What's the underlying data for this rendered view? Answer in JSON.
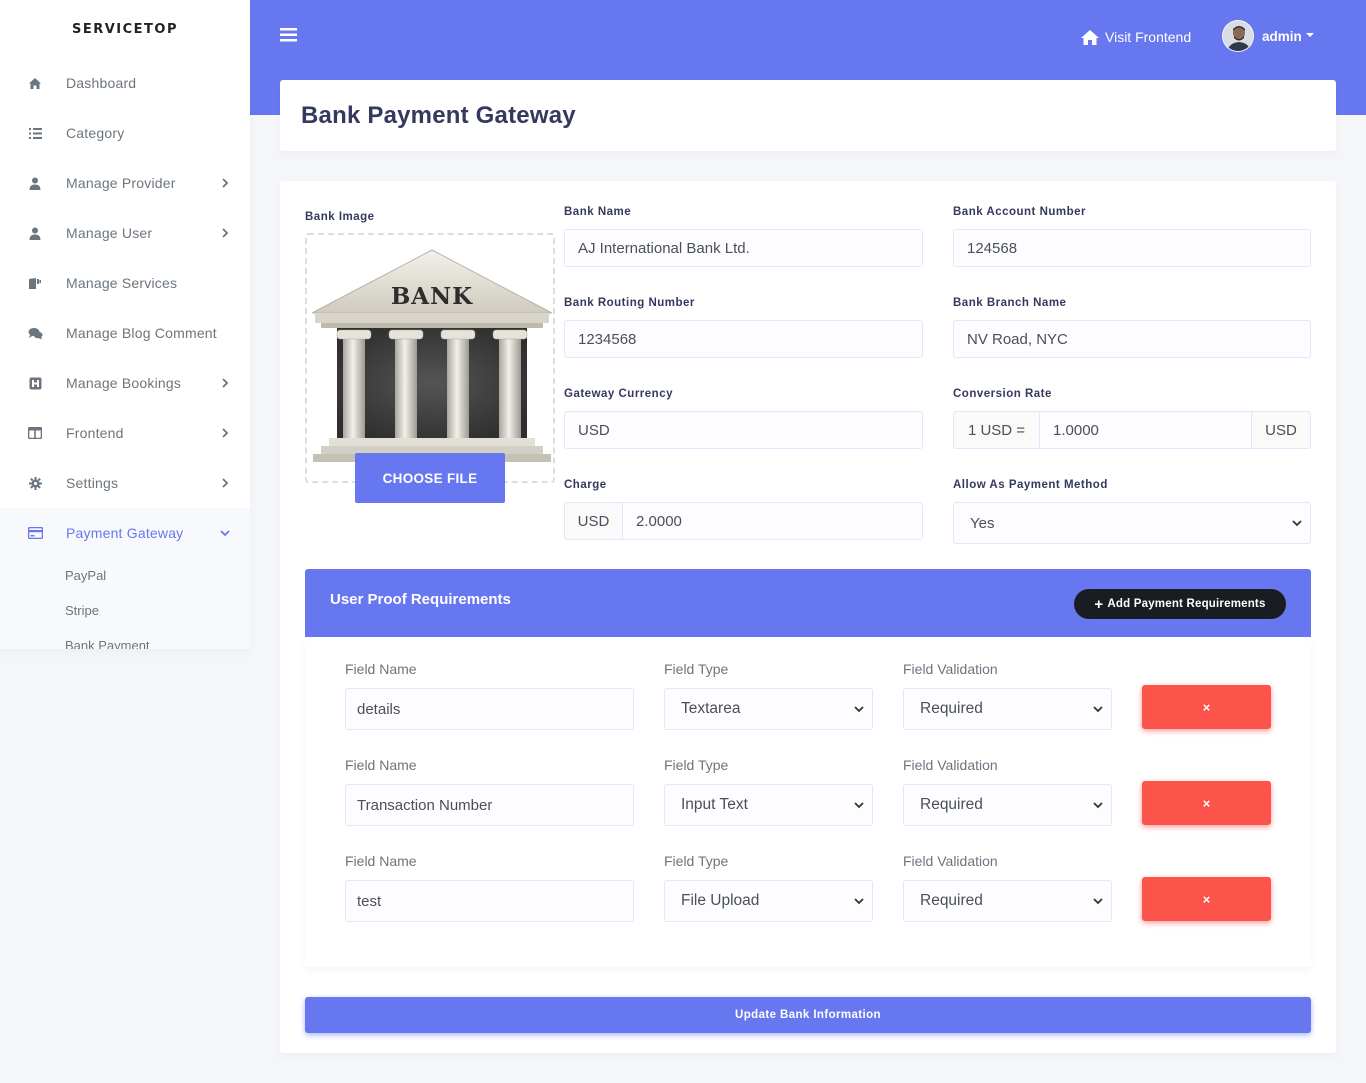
{
  "brand": "SERVICETOP",
  "sidebar": {
    "items": [
      {
        "label": "Dashboard",
        "icon": "home-icon",
        "has_chevron": false
      },
      {
        "label": "Category",
        "icon": "list-icon",
        "has_chevron": false
      },
      {
        "label": "Manage Provider",
        "icon": "user-icon",
        "has_chevron": true
      },
      {
        "label": "Manage User",
        "icon": "user-icon",
        "has_chevron": true
      },
      {
        "label": "Manage Services",
        "icon": "services-icon",
        "has_chevron": false
      },
      {
        "label": "Manage Blog Comment",
        "icon": "comments-icon",
        "has_chevron": false
      },
      {
        "label": "Manage Bookings",
        "icon": "bookings-icon",
        "has_chevron": true
      },
      {
        "label": "Frontend",
        "icon": "columns-icon",
        "has_chevron": true
      },
      {
        "label": "Settings",
        "icon": "gear-icon",
        "has_chevron": true
      },
      {
        "label": "Payment Gateway",
        "icon": "credit-card-icon",
        "has_chevron": true,
        "active": true
      }
    ],
    "subitems": [
      "PayPal",
      "Stripe",
      "Bank Payment"
    ]
  },
  "topbar": {
    "visit_frontend": "Visit Frontend",
    "user_name": "admin"
  },
  "page_title": "Bank Payment Gateway",
  "form": {
    "bank_image_label": "Bank Image",
    "bank_image_text": "BANK",
    "choose_file": "CHOOSE FILE",
    "bank_name_label": "Bank Name",
    "bank_name": "AJ International Bank Ltd.",
    "account_number_label": "Bank Account Number",
    "account_number": "124568",
    "routing_number_label": "Bank Routing Number",
    "routing_number": "1234568",
    "branch_name_label": "Bank Branch Name",
    "branch_name": "NV Road, NYC",
    "gateway_currency_label": "Gateway Currency",
    "gateway_currency": "USD",
    "conversion_rate_label": "Conversion Rate",
    "conversion_prefix": "1 USD =",
    "conversion_rate": "1.0000",
    "conversion_suffix": "USD",
    "charge_label": "Charge",
    "charge_prefix": "USD",
    "charge": "2.0000",
    "allow_label": "Allow As Payment Method",
    "allow_value": "Yes"
  },
  "requirements": {
    "title": "User Proof Requirements",
    "add_button": "Add Payment Requirements",
    "rows": [
      {
        "field_name_label": "Field Name",
        "field_name": "details",
        "field_type_label": "Field Type",
        "field_type": "Textarea",
        "validation_label": "Field Validation",
        "validation": "Required",
        "delete": "×"
      },
      {
        "field_name_label": "Field Name",
        "field_name": "Transaction Number",
        "field_type_label": "Field Type",
        "field_type": "Input Text",
        "validation_label": "Field Validation",
        "validation": "Required",
        "delete": "×"
      },
      {
        "field_name_label": "Field Name",
        "field_name": "test",
        "field_type_label": "Field Type",
        "field_type": "File Upload",
        "validation_label": "Field Validation",
        "validation": "Required",
        "delete": "×"
      }
    ]
  },
  "update_button": "Update Bank Information",
  "colors": {
    "primary": "#6777ef",
    "danger": "#fc544b",
    "dark": "#191d21"
  }
}
